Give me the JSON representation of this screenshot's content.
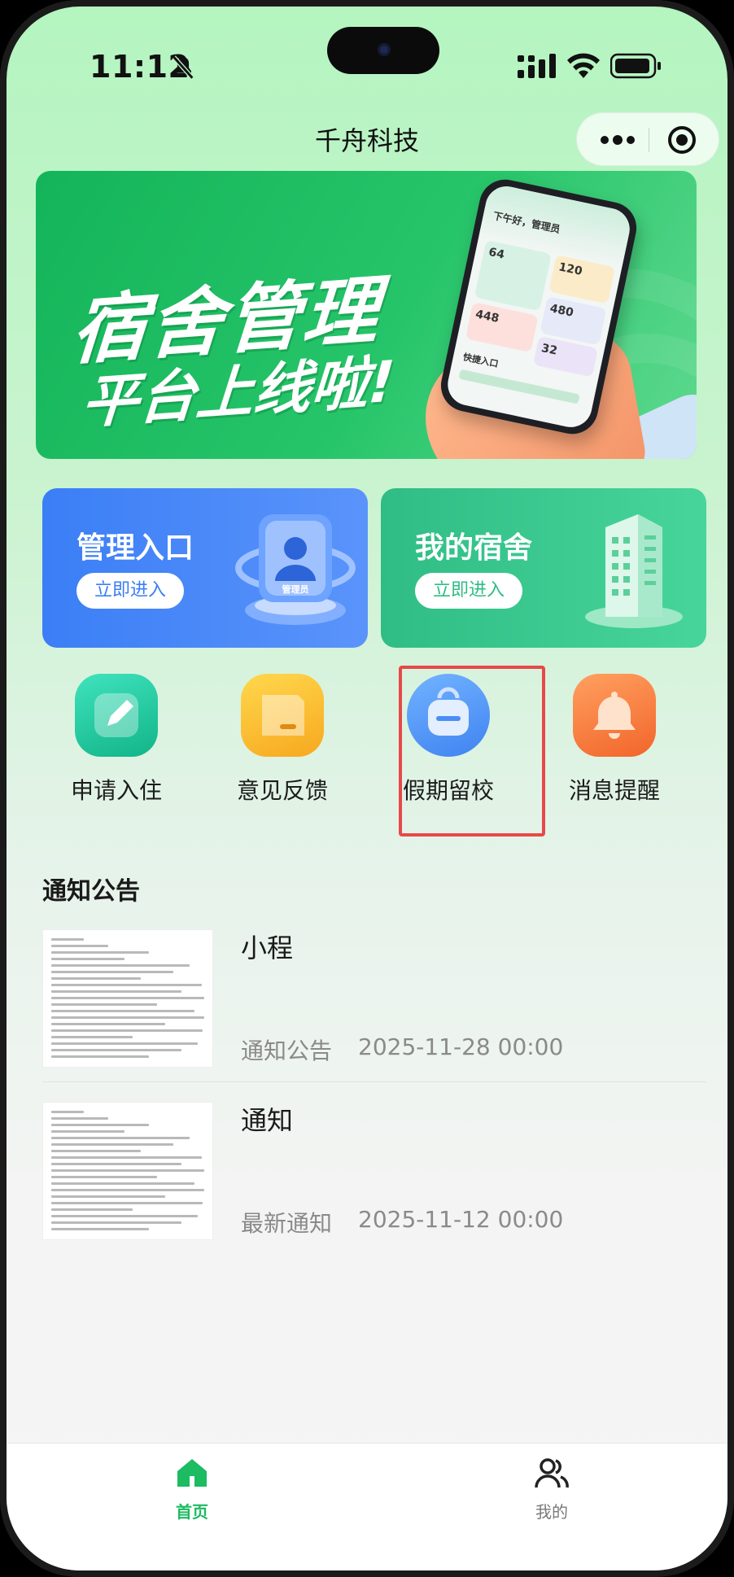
{
  "status_bar": {
    "time": "11:12"
  },
  "nav": {
    "title": "千舟科技"
  },
  "banner": {
    "line1": "宿舍管理",
    "line2": "平台上线啦!",
    "phone": {
      "greeting": "下午好，管理员",
      "stats": [
        "64",
        "120",
        "448",
        "480",
        "32"
      ],
      "section": "快捷入口"
    }
  },
  "entries": [
    {
      "title": "管理入口",
      "button": "立即进入",
      "art_label": "管理员"
    },
    {
      "title": "我的宿舍",
      "button": "立即进入"
    }
  ],
  "actions": [
    {
      "label": "申请入住",
      "icon": "pencil-icon",
      "color": "#18c093"
    },
    {
      "label": "意见反馈",
      "icon": "note-icon",
      "color": "#fbc02d"
    },
    {
      "label": "假期留校",
      "icon": "backpack-icon",
      "color": "#4a8ef5"
    },
    {
      "label": "消息提醒",
      "icon": "bell-icon",
      "color": "#f4752f"
    }
  ],
  "notices": {
    "title": "通知公告",
    "items": [
      {
        "title": "小程",
        "category": "通知公告",
        "date": "2025-11-28 00:00"
      },
      {
        "title": "通知",
        "category": "最新通知",
        "date": "2025-11-12 00:00"
      }
    ]
  },
  "tabbar": {
    "items": [
      {
        "label": "首页",
        "icon": "home-icon",
        "active": true
      },
      {
        "label": "我的",
        "icon": "users-icon",
        "active": false
      }
    ]
  },
  "colors": {
    "accent": "#1dbb62",
    "highlight": "#e8484a"
  }
}
